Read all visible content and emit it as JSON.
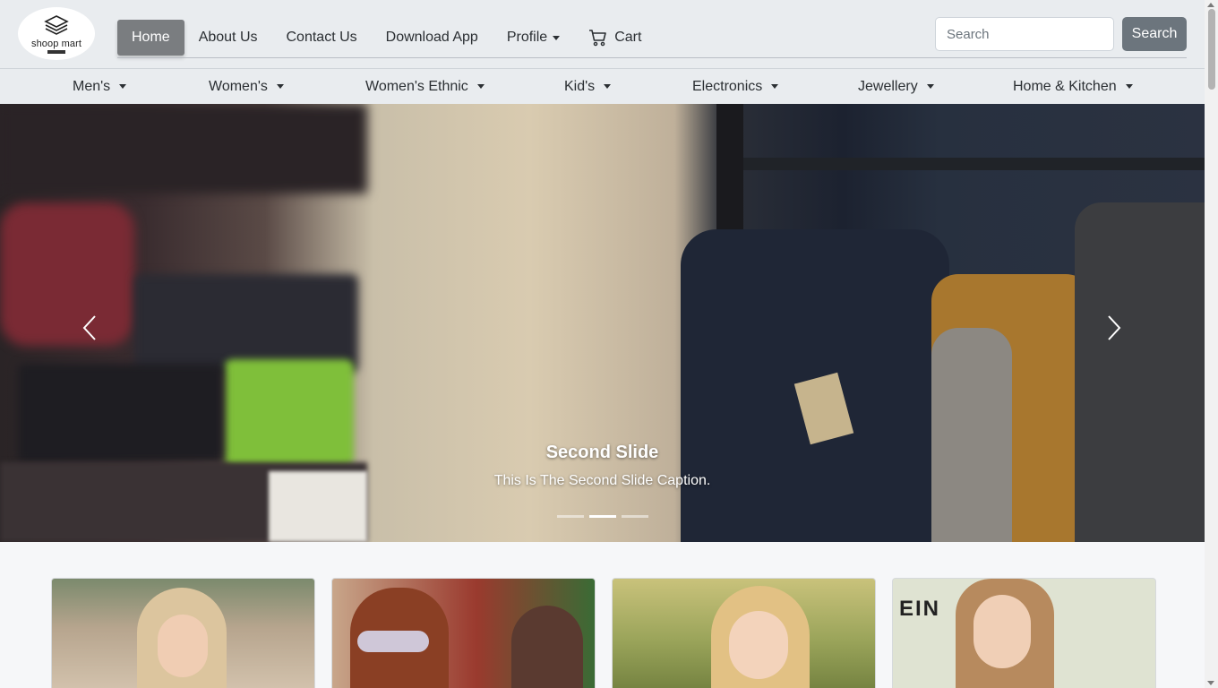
{
  "brand": {
    "name": "shoop mart",
    "logo_icon": "diamond-layers-icon"
  },
  "nav": {
    "items": [
      {
        "label": "Home",
        "active": true
      },
      {
        "label": "About Us",
        "active": false
      },
      {
        "label": "Contact Us",
        "active": false
      },
      {
        "label": "Download App",
        "active": false
      },
      {
        "label": "Profile",
        "active": false,
        "dropdown": true
      },
      {
        "label": "Cart",
        "active": false,
        "icon": "cart-icon"
      }
    ]
  },
  "search": {
    "placeholder": "Search",
    "button_label": "Search"
  },
  "categories": [
    {
      "label": "Men's"
    },
    {
      "label": "Women's"
    },
    {
      "label": "Women's Ethnic"
    },
    {
      "label": "Kid's"
    },
    {
      "label": "Electronics"
    },
    {
      "label": "Jewellery"
    },
    {
      "label": "Home & Kitchen"
    }
  ],
  "carousel": {
    "title": "Second Slide",
    "caption": "This Is The Second Slide Caption.",
    "active_index": 1,
    "slide_count": 3
  },
  "cards": [
    {
      "label": ""
    },
    {
      "label": ""
    },
    {
      "label": ""
    },
    {
      "label": "EIN"
    }
  ],
  "colors": {
    "navbar_bg": "#e9ecef",
    "active_nav": "#7a7d80",
    "search_button": "#6c757d",
    "page_bg": "#f6f7f9"
  }
}
